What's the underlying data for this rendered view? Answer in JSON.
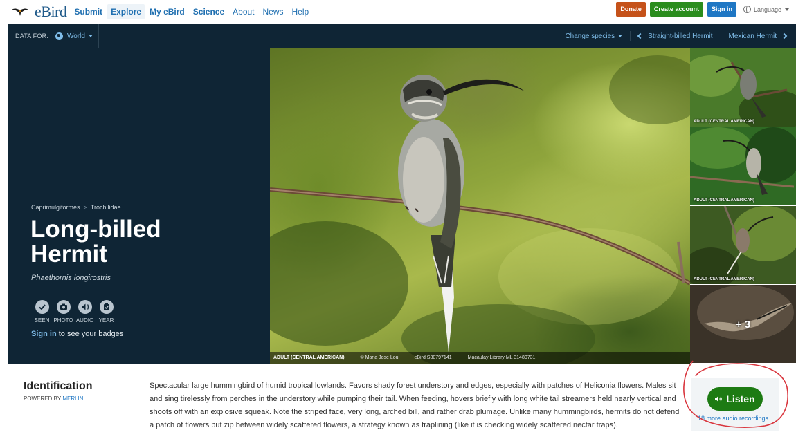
{
  "nav": {
    "logo_text": "eBird",
    "links": [
      "Submit",
      "Explore",
      "My eBird",
      "Science",
      "About",
      "News",
      "Help"
    ],
    "donate": "Donate",
    "create_account": "Create account",
    "sign_in": "Sign in",
    "language": "Language"
  },
  "databar": {
    "data_for": "DATA FOR:",
    "region": "World",
    "change_species": "Change species",
    "prev_species": "Straight-billed Hermit",
    "next_species": "Mexican Hermit"
  },
  "species": {
    "order": "Caprimulgiformes",
    "family": "Trochilidae",
    "crumb_sep": ">",
    "common_name": "Long-billed Hermit",
    "scientific_name": "Phaethornis longirostris",
    "badges": [
      "SEEN",
      "PHOTO",
      "AUDIO",
      "YEAR"
    ],
    "signin_link": "Sign in",
    "signin_text": " to see your badges"
  },
  "photo": {
    "caption_label": "ADULT (CENTRAL AMERICAN)",
    "credit": "© Maria Jose Lou",
    "checklist": "eBird S30797141",
    "library": "Macaulay Library ML 31480731"
  },
  "thumbnails": {
    "captions": [
      "ADULT (CENTRAL AMERICAN)",
      "ADULT (CENTRAL AMERICAN)",
      "ADULT (CENTRAL AMERICAN)"
    ],
    "more": "+ 3"
  },
  "identification": {
    "title": "Identification",
    "powered_by": "POWERED BY ",
    "merlin": "MERLIN",
    "text": "Spectacular large hummingbird of humid tropical lowlands. Favors shady forest understory and edges, especially with patches of Heliconia flowers. Males sit and sing tirelessly from perches in the understory while pumping their tail. When feeding, hovers briefly with long white tail streamers held nearly vertical and shoots off with an explosive squeak. Note the striped face, very long, arched bill, and rather drab plumage. Unlike many hummingbirds, hermits do not defend a patch of flowers but zip between widely scattered flowers, a strategy known as traplining (like it is checking widely scattered nectar traps).",
    "listen": "Listen",
    "more_audio": "18 more audio recordings"
  },
  "colors": {
    "navy": "#0f2535",
    "link_blue": "#1f77c4",
    "light_blue": "#7fbde9",
    "donate": "#c5521a",
    "create": "#2b8d1e",
    "listen": "#1d7b13",
    "annotation_red": "#d9363e"
  }
}
